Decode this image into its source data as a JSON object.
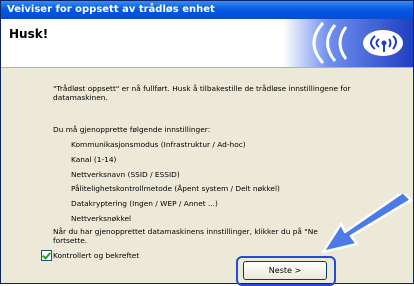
{
  "window": {
    "title": "Veiviser for oppsett av trådløs enhet"
  },
  "header": {
    "title": "Husk!"
  },
  "body": {
    "intro_line1": "\"Trådløst oppsett\" er nå fullført. Husk å tilbakestille de trådløse innstillingene for",
    "intro_line2": "datamaskinen.",
    "restore_heading": "Du må gjenopprette følgende innstillinger:",
    "settings": [
      "Kommunikasjonsmodus (Infrastruktur / Ad-hoc)",
      "Kanal (1-14)",
      "Nettverksnavn (SSID / ESSID)",
      "Pålitelighetskontrollmetode (Åpent system / Delt nøkkel)",
      "Datakryptering (Ingen / WEP / Annet ...)",
      "Nettverksnøkkel"
    ],
    "final_line1": "Når du har gjenopprettet datamaskinens innstillinger, klikker du på \"Ne",
    "final_line2": "fortsette."
  },
  "checkbox": {
    "label": "Kontrollert og bekreftet",
    "checked": true
  },
  "buttons": {
    "next_label": "Neste >"
  },
  "colors": {
    "title_bar": "#0054e3",
    "frame": "#ece9d8",
    "highlight": "#1f4fd6",
    "logo": "#2553d7"
  },
  "icons": {
    "logo": "wireless-signal-logo-icon",
    "pointer": "arrow-pointer-icon"
  }
}
